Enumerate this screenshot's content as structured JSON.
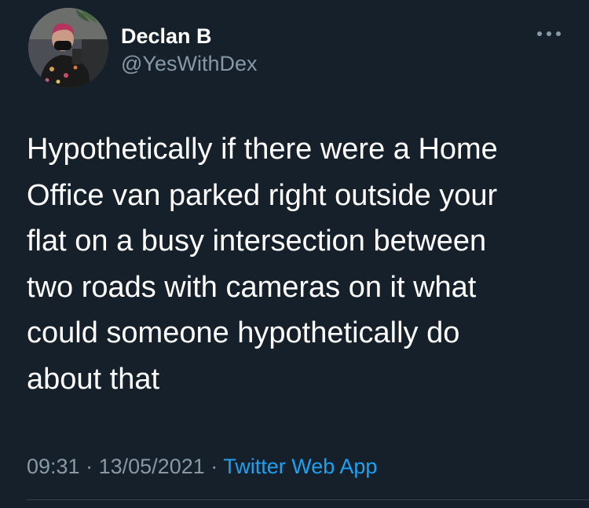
{
  "tweet": {
    "display_name": "Declan B",
    "handle": "@YesWithDex",
    "text": "Hypothetically if there were a Home\nOffice van parked right outside your\nflat on a busy intersection between\ntwo roads with cameras on it what\ncould someone hypothetically do\nabout that",
    "time": "09:31",
    "separator": "·",
    "date": "13/05/2021",
    "source": "Twitter Web App"
  },
  "icons": {
    "more": "more-horizontal-icon",
    "avatar": "profile-photo"
  },
  "colors": {
    "background": "#15202b",
    "primary_text": "#ffffff",
    "secondary_text": "#8899a6",
    "link": "#1da1f2",
    "divider": "#38444d"
  }
}
